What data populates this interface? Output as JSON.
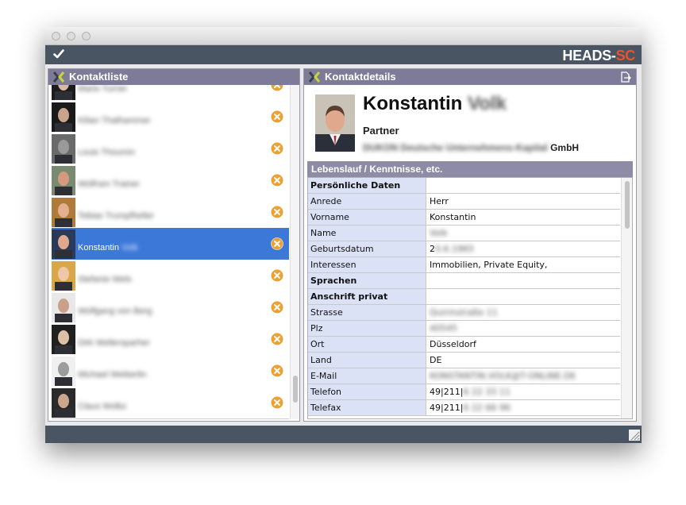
{
  "toolbar": {
    "logo_main": "HEADS-",
    "logo_accent": "SC",
    "accent_color": "#e9542a"
  },
  "left_panel": {
    "title": "Kontaktliste",
    "contacts": [
      {
        "first": "",
        "last": "Mario Turner"
      },
      {
        "first": "",
        "last": "Kilian Thalhammer"
      },
      {
        "first": "",
        "last": "Louis Thoumin"
      },
      {
        "first": "",
        "last": "Wolfram Trainer"
      },
      {
        "first": "",
        "last": "Tobias Trumpfheller"
      },
      {
        "first": "Konstantin",
        "last": "Volk",
        "selected": true
      },
      {
        "first": "",
        "last": "Stefanie Wels"
      },
      {
        "first": "",
        "last": "Wolfgang von Berg"
      },
      {
        "first": "",
        "last": "Dirk Wellersparher"
      },
      {
        "first": "",
        "last": "Michael Weiberlin"
      },
      {
        "first": "",
        "last": "Claus Wolbz"
      }
    ]
  },
  "right_panel": {
    "title": "Kontaktdetails",
    "name_first": "Konstantin",
    "name_last": "Volk",
    "role": "Partner",
    "company_blurred": "DUKON Deutsche Unternehmens-Kapital",
    "company_suffix": "GmbH",
    "section_title": "Lebenslauf / Kenntnisse, etc.",
    "rows": [
      {
        "label": "Persönliche Daten",
        "value": "",
        "bold": true
      },
      {
        "label": "Anrede",
        "value": "Herr"
      },
      {
        "label": "Vorname",
        "value": "Konstantin"
      },
      {
        "label": "Name",
        "value": "",
        "blurred": "Volk"
      },
      {
        "label": "Geburtsdatum",
        "value": "2",
        "blurred": "0.6.1965"
      },
      {
        "label": "Interessen",
        "value": "Immobilien, Private Equity,"
      },
      {
        "label": "Sprachen",
        "value": "",
        "bold": true
      },
      {
        "label": "Anschrift privat",
        "value": "",
        "bold": true
      },
      {
        "label": "Strasse",
        "value": "",
        "blurred": "Quirinstraße 11"
      },
      {
        "label": "Plz",
        "value": "",
        "blurred": "40545"
      },
      {
        "label": "Ort",
        "value": "Düsseldorf"
      },
      {
        "label": "Land",
        "value": "DE"
      },
      {
        "label": "E-Mail",
        "value": "",
        "blurred": "KONSTANTIN.VOLK@T-ONLINE.DE"
      },
      {
        "label": "Telefon",
        "value": "49|211|",
        "blurred": "6 22 33 11"
      },
      {
        "label": "Telefax",
        "value": "49|211|",
        "blurred": "6 22 66 96"
      }
    ]
  },
  "colors": {
    "panel_header": "#7d7b97",
    "selected_row": "#3b78d8",
    "remove_icon": "#f0a030",
    "table_label_bg": "#dce2f6"
  }
}
